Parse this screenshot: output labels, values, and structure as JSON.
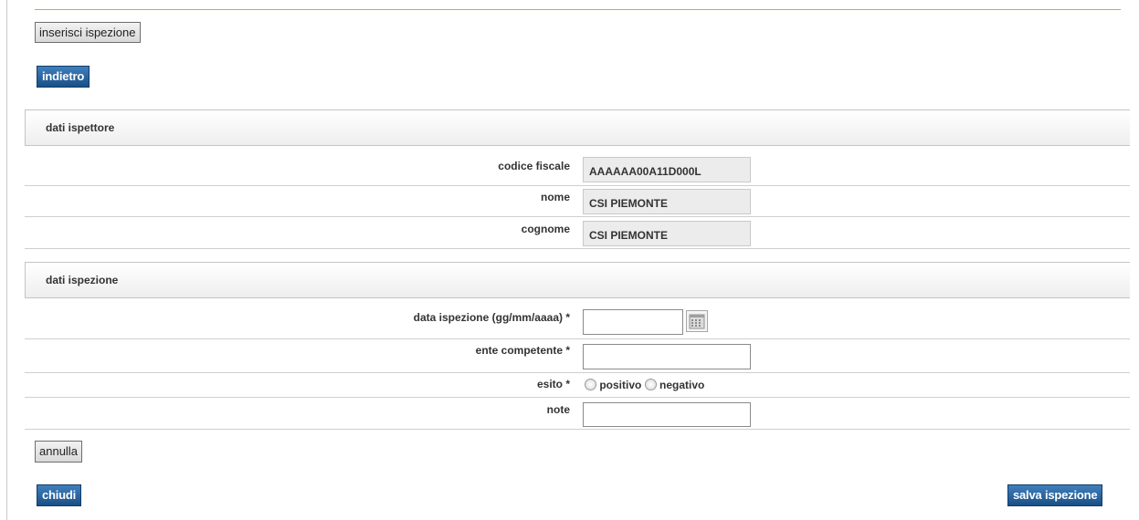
{
  "toolbar": {
    "title_button": "inserisci ispezione",
    "back_button": "indietro"
  },
  "inspector": {
    "section_title": "dati ispettore",
    "fields": [
      {
        "label": "codice fiscale",
        "value": "AAAAAA00A11D000L"
      },
      {
        "label": "nome",
        "value": "CSI PIEMONTE"
      },
      {
        "label": "cognome",
        "value": "CSI PIEMONTE"
      }
    ]
  },
  "inspection": {
    "section_title": "dati ispezione",
    "date_label": "data ispezione (gg/mm/aaaa) *",
    "date_value": "",
    "authority_label": "ente competente *",
    "authority_value": "",
    "outcome_label": "esito *",
    "outcome_options": [
      "positivo",
      "negativo"
    ],
    "notes_label": "note",
    "notes_value": ""
  },
  "footer": {
    "cancel_button": "annulla",
    "close_button": "chiudi",
    "save_button": "salva ispezione"
  },
  "colors": {
    "accent_rule": "#e8a317",
    "primary_button": "#1a4f86"
  }
}
